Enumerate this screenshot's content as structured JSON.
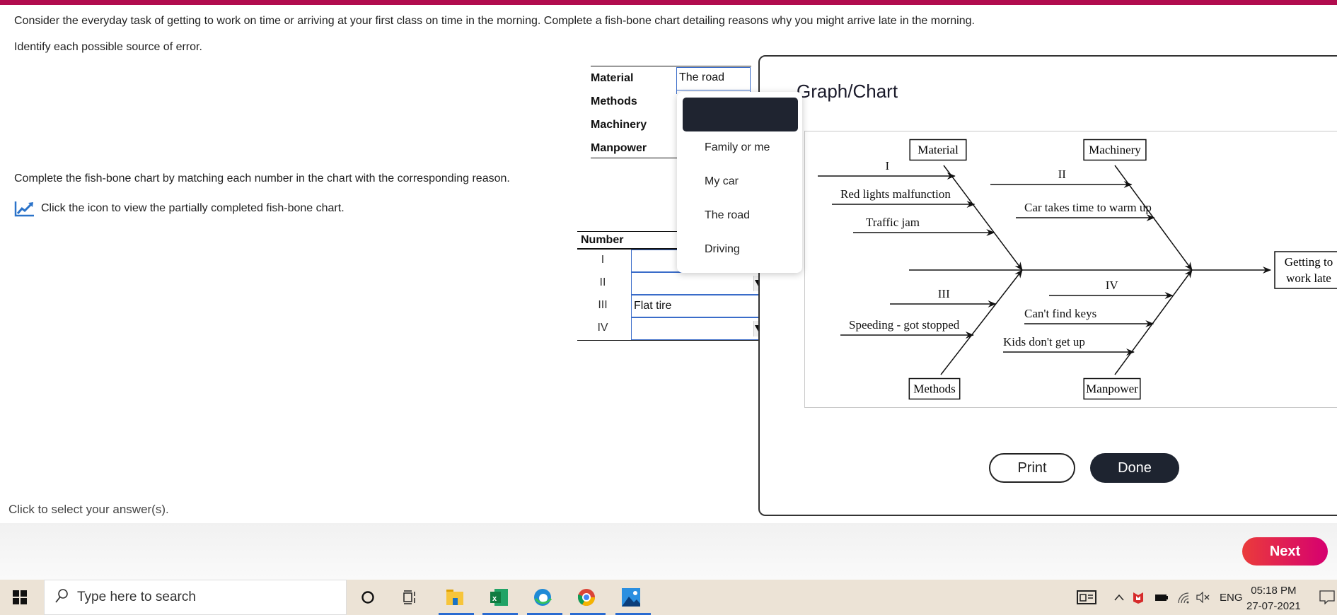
{
  "question": {
    "line1": "Consider the everyday task of getting to work on time or arriving at your first class on time in the morning. Complete a fish-bone chart detailing reasons why you might arrive late in the morning.",
    "line2": "Identify each possible source of error.",
    "instruction": "Complete the fish-bone chart by matching each number in the chart with the corresponding reason.",
    "chart_link": "Click the icon to view the partially completed fish-bone chart.",
    "hint": "Click to select your answer(s)."
  },
  "categories": {
    "rows": [
      {
        "label": "Material",
        "value": "The road"
      },
      {
        "label": "Methods",
        "value": ""
      },
      {
        "label": "Machinery",
        "value": ""
      },
      {
        "label": "Manpower",
        "value": ""
      }
    ]
  },
  "dropdown": {
    "selected": "",
    "options": [
      "Family or me",
      "My car",
      "The road",
      "Driving"
    ]
  },
  "numbers": {
    "header": "Number",
    "rows": [
      {
        "label": "I",
        "value": ""
      },
      {
        "label": "II",
        "value": ""
      },
      {
        "label": "III",
        "value": "Flat tire"
      },
      {
        "label": "IV",
        "value": ""
      }
    ]
  },
  "modal": {
    "title": "Graph/Chart",
    "print_label": "Print",
    "done_label": "Done"
  },
  "chart_data": {
    "type": "fishbone",
    "effect": [
      "Getting to",
      "work late"
    ],
    "categories": [
      "Material",
      "Machinery",
      "Methods",
      "Manpower"
    ],
    "causes": {
      "Material": [
        "I",
        "Red lights malfunction",
        "Traffic jam"
      ],
      "Machinery": [
        "II",
        "Car takes time to warm up"
      ],
      "Methods": [
        "III",
        "Speeding - got stopped"
      ],
      "Manpower": [
        "IV",
        "Can't find keys",
        "Kids don't get up"
      ]
    }
  },
  "footer": {
    "next_label": "Next"
  },
  "taskbar": {
    "search_placeholder": "Type here to search",
    "language": "ENG",
    "time": "05:18 PM",
    "date": "27-07-2021"
  }
}
